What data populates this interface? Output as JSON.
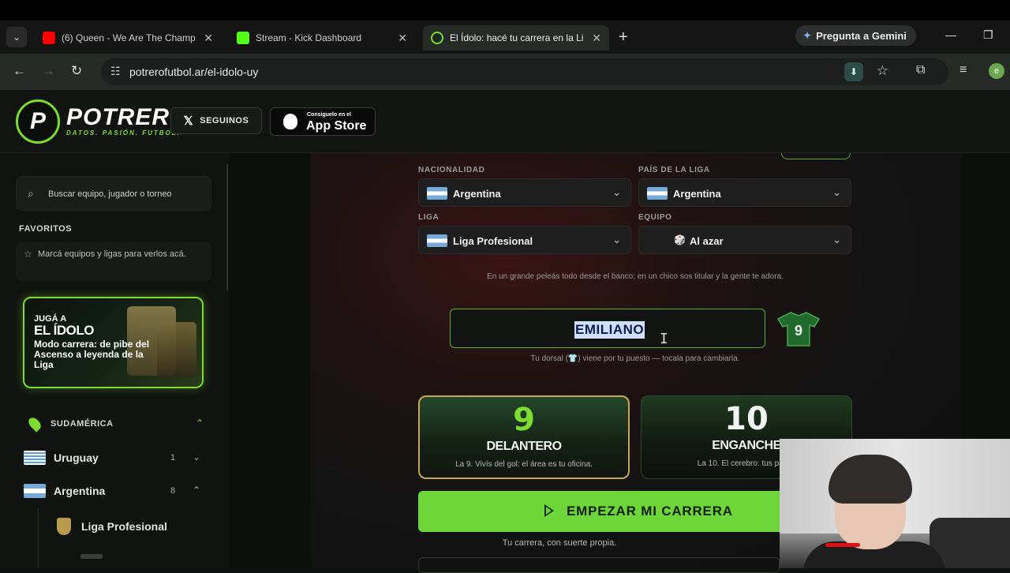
{
  "browser": {
    "tabs": [
      {
        "title": "(6) Queen - We Are The Champ",
        "favicon_color": "#ff0000",
        "active": false
      },
      {
        "title": "Stream - Kick Dashboard",
        "favicon_color": "#53fc18",
        "active": false
      },
      {
        "title": "El Ídolo: hacé tu carrera en la Li",
        "favicon_color": "#7ddc2e",
        "active": true
      }
    ],
    "gemini_label": "Pregunta a Gemini",
    "url": "potrerofutbol.ar/el-idolo-uy",
    "profile_initial": "e"
  },
  "header": {
    "logo_letter": "P",
    "logo_name": "POTRERO",
    "logo_tagline": "DATOS. PASIÓN. FUTBOL.",
    "follow_label": "SEGUINOS",
    "appstore_small": "Consiguelo en el",
    "appstore_big": "App Store"
  },
  "sidebar": {
    "search_placeholder": "Buscar equipo, jugador o torneo",
    "favorites_title": "FAVORITOS",
    "favorites_empty": "Marcá equipos y ligas para verlos acá.",
    "promo": {
      "line1": "JUGÁ A",
      "line2": "EL ÍDOLO",
      "line3": "Modo carrera: de pibe del Ascenso a leyenda de la Liga"
    },
    "region": "SUDAMÉRICA",
    "countries": [
      {
        "name": "Uruguay",
        "count": "1",
        "expanded": false
      },
      {
        "name": "Argentina",
        "count": "8",
        "expanded": true
      }
    ],
    "league": "Liga Profesional"
  },
  "form": {
    "nationality_label": "NACIONALIDAD",
    "nationality_value": "Argentina",
    "league_country_label": "PAÍS DE LA LIGA",
    "league_country_value": "Argentina",
    "league_label": "LIGA",
    "league_value": "Liga Profesional",
    "team_label": "EQUIPO",
    "team_value": "Al azar",
    "hint": "En un grande peleás todo desde el banco; en un chico sos titular y la gente te adora.",
    "player_name": "EMILIANO",
    "jersey_number": "9",
    "dorsal_hint_before": "Tu dorsal (",
    "dorsal_hint_after": ") viene por tu puesto — tocala para cambiarla.",
    "positions": [
      {
        "number": "9",
        "role": "DELANTERO",
        "desc": "La 9. Vivís del gol: el área es tu oficina.",
        "selected": true
      },
      {
        "number": "10",
        "role": "ENGANCHE",
        "desc": "La 10. El cerebro: tus pases",
        "selected": false
      }
    ],
    "start_label": "EMPEZAR MI CARRERA",
    "luck_text": "Tu carrera, con suerte propia."
  },
  "colors": {
    "accent": "#7ddc2e",
    "button": "#6fd63a",
    "selected_card_border": "#c9a74e",
    "selection_highlight": "#cfe0ff"
  }
}
